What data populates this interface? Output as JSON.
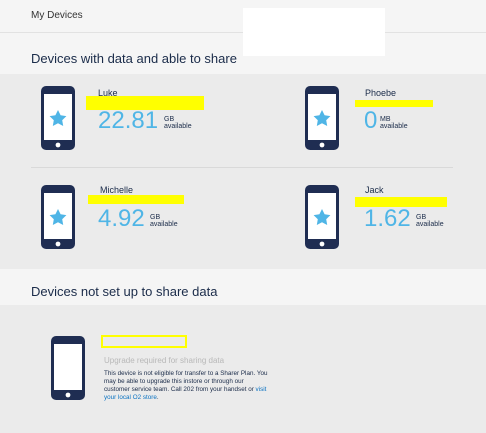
{
  "header": {
    "breadcrumb": "My Devices"
  },
  "sections": {
    "sharing_title": "Devices with data and able to share",
    "not_setup_title": "Devices not set up to share data"
  },
  "devices": [
    {
      "name": "Luke",
      "amount": "22.81",
      "unit": "GB",
      "unit_sub": "available"
    },
    {
      "name": "Phoebe",
      "amount": "0",
      "unit": "MB",
      "unit_sub": "available"
    },
    {
      "name": "Michelle",
      "amount": "4.92",
      "unit": "GB",
      "unit_sub": "available"
    },
    {
      "name": "Jack",
      "amount": "1.62",
      "unit": "GB",
      "unit_sub": "available"
    }
  ],
  "not_setup_device": {
    "status": "Upgrade required for sharing data",
    "message": "This device is not eligible for transfer to a Sharer Plan. You may be able to upgrade this instore or through our customer service team. Call 202 from your handset or",
    "link_text": "visit your local O2 store",
    "after_link": "."
  },
  "colors": {
    "phone_body": "#1f2d52",
    "star": "#4fb5e6",
    "highlight": "#ffff00",
    "amount": "#4fb5e6"
  },
  "icons": {
    "phone": "phone-icon",
    "star": "star-icon"
  }
}
